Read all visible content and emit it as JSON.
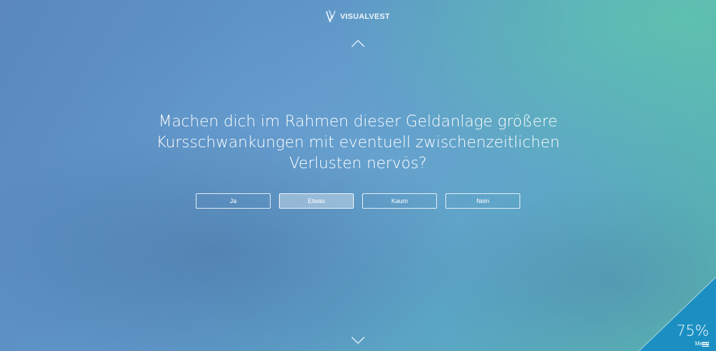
{
  "brand": {
    "name": "VISUALVEST",
    "logo_icon": "visualvest-v-logo-icon"
  },
  "navigation": {
    "up_icon": "chevron-up-icon",
    "down_icon": "chevron-down-icon"
  },
  "question": {
    "line1": "Machen dich im Rahmen dieser Geldanlage größere",
    "line2": "Kursschwankungen mit eventuell zwischenzeitlichen",
    "line3": "Verlusten nervös?"
  },
  "answers": [
    {
      "label": "Ja",
      "selected": false
    },
    {
      "label": "Etwas",
      "selected": true
    },
    {
      "label": "Kaum",
      "selected": false
    },
    {
      "label": "Nein",
      "selected": false
    }
  ],
  "progress": {
    "value": "75%",
    "fraction": 0.75
  },
  "menu": {
    "label": "Menu",
    "icon": "hamburger-menu-icon"
  },
  "colors": {
    "accent": "#1b8fc2",
    "background_start": "#5a88bf",
    "background_end": "#57b6ad",
    "text": "#ffffff"
  }
}
